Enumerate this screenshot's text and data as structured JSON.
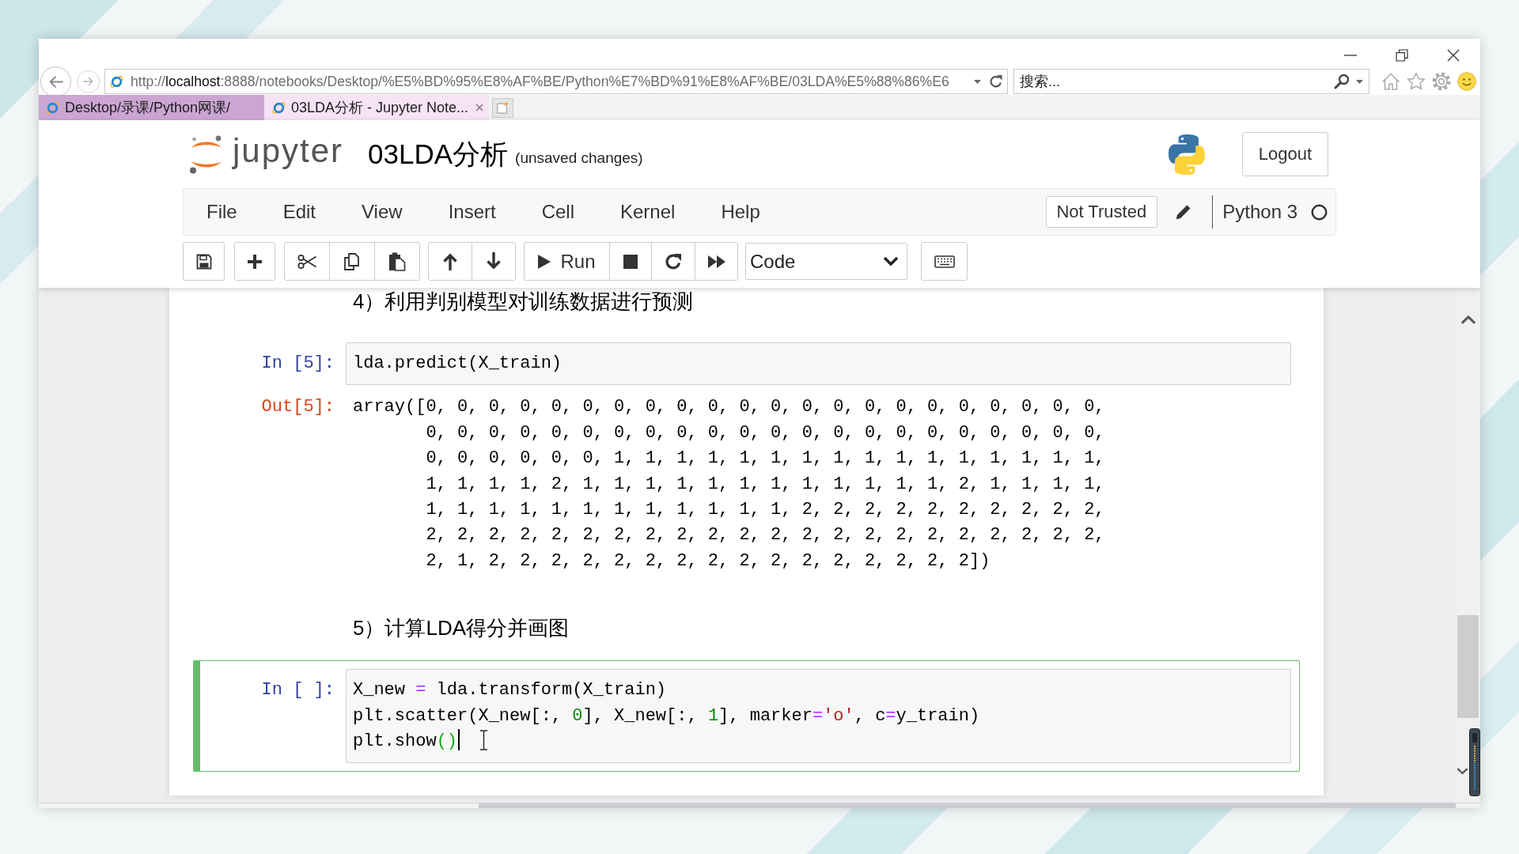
{
  "browser": {
    "address": {
      "parts": [
        {
          "text": "http://",
          "kind": "dim"
        },
        {
          "text": "localhost",
          "kind": "host"
        },
        {
          "text": ":8888/notebooks/Desktop/%E5%BD%95%E8%AF%BE/Python%E7%BD%91%E8%AF%BE/03LDA%E5%88%86%E6",
          "kind": "dim"
        }
      ]
    },
    "search": {
      "placeholder": "搜索..."
    },
    "tabs": [
      {
        "label": "Desktop/录课/Python网课/",
        "selected": false
      },
      {
        "label": "03LDA分析 - Jupyter Note...",
        "selected": true
      }
    ]
  },
  "header": {
    "logo_text": "jupyter",
    "notebook_name": "03LDA分析",
    "save_status": "(unsaved changes)",
    "logout": "Logout"
  },
  "menu": {
    "items": [
      "File",
      "Edit",
      "View",
      "Insert",
      "Cell",
      "Kernel",
      "Help"
    ],
    "trust_button": "Not Trusted",
    "kernel_name": "Python 3",
    "kernel_busy": false
  },
  "toolbar": {
    "run_label": "Run",
    "cell_type": "Code"
  },
  "cells": [
    {
      "kind": "markdown",
      "text": "4）利用判别模型对训练数据进行预测",
      "selected": false
    },
    {
      "kind": "code",
      "prompt": "In [5]:",
      "selected": false,
      "editing": false,
      "lines": [
        [
          {
            "text": "lda.predict(X_train)",
            "kind": "plain"
          }
        ]
      ],
      "output": {
        "prompt": "Out[5]:",
        "text": "array([0, 0, 0, 0, 0, 0, 0, 0, 0, 0, 0, 0, 0, 0, 0, 0, 0, 0, 0, 0, 0, 0,\n       0, 0, 0, 0, 0, 0, 0, 0, 0, 0, 0, 0, 0, 0, 0, 0, 0, 0, 0, 0, 0, 0,\n       0, 0, 0, 0, 0, 0, 1, 1, 1, 1, 1, 1, 1, 1, 1, 1, 1, 1, 1, 1, 1, 1,\n       1, 1, 1, 1, 2, 1, 1, 1, 1, 1, 1, 1, 1, 1, 1, 1, 1, 2, 1, 1, 1, 1,\n       1, 1, 1, 1, 1, 1, 1, 1, 1, 1, 1, 1, 2, 2, 2, 2, 2, 2, 2, 2, 2, 2,\n       2, 2, 2, 2, 2, 2, 2, 2, 2, 2, 2, 2, 2, 2, 2, 2, 2, 2, 2, 2, 2, 2,\n       2, 1, 2, 2, 2, 2, 2, 2, 2, 2, 2, 2, 2, 2, 2, 2, 2, 2])"
      }
    },
    {
      "kind": "markdown",
      "text": "5）计算LDA得分并画图",
      "selected": false
    },
    {
      "kind": "code",
      "prompt": "In [ ]:",
      "selected": true,
      "editing": true,
      "lines": [
        [
          {
            "text": "X_new ",
            "kind": "plain"
          },
          {
            "text": "=",
            "kind": "operator"
          },
          {
            "text": " lda.transform(X_train)",
            "kind": "plain"
          }
        ],
        [
          {
            "text": "plt.scatter(X_new[:, ",
            "kind": "plain"
          },
          {
            "text": "0",
            "kind": "number"
          },
          {
            "text": "], X_new[:, ",
            "kind": "plain"
          },
          {
            "text": "1",
            "kind": "number"
          },
          {
            "text": "], marker",
            "kind": "plain"
          },
          {
            "text": "=",
            "kind": "operator"
          },
          {
            "text": "'o'",
            "kind": "string"
          },
          {
            "text": ", c",
            "kind": "plain"
          },
          {
            "text": "=",
            "kind": "operator"
          },
          {
            "text": "y_train)",
            "kind": "plain"
          }
        ],
        [
          {
            "text": "plt.show",
            "kind": "plain"
          },
          {
            "text": "()",
            "kind": "bracket"
          }
        ]
      ]
    }
  ]
}
